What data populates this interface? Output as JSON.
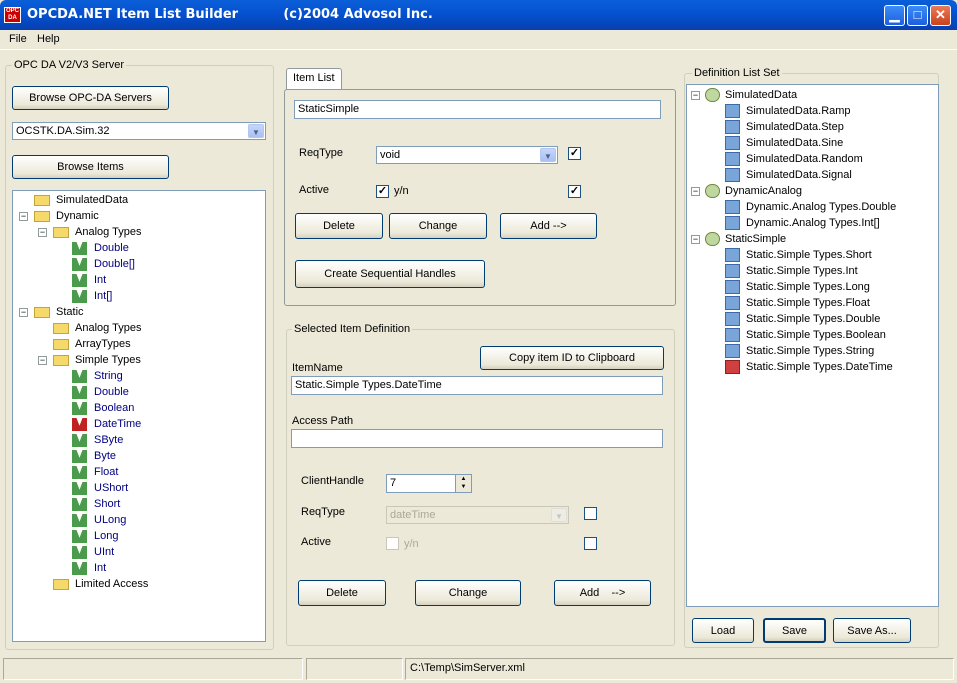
{
  "window": {
    "title": "OPCDA.NET Item List Builder          (c)2004 Advosol Inc.",
    "app_icon_text": "OPC\nDA",
    "minimize_glyph": "▁",
    "maximize_glyph": "□",
    "close_glyph": "✕"
  },
  "menu": {
    "file": "File",
    "help": "Help"
  },
  "server_group": {
    "label": "OPC DA V2/V3 Server",
    "browse_servers_label": "Browse OPC-DA Servers",
    "server_value": "OCSTK.DA.Sim.32",
    "browse_items_label": "Browse Items"
  },
  "browse_tree": {
    "items": [
      {
        "label": "SimulatedData",
        "pm": ""
      },
      {
        "label": "Dynamic",
        "pm": "−"
      },
      {
        "label": "Analog Types",
        "pm": "−"
      },
      {
        "label": "Double"
      },
      {
        "label": "Double[]"
      },
      {
        "label": "Int"
      },
      {
        "label": "Int[]"
      },
      {
        "label": "Static",
        "pm": "−"
      },
      {
        "label": "Analog Types",
        "pm": ""
      },
      {
        "label": "ArrayTypes",
        "pm": ""
      },
      {
        "label": "Simple Types",
        "pm": "−"
      },
      {
        "label": "String"
      },
      {
        "label": "Double"
      },
      {
        "label": "Boolean"
      },
      {
        "label": "DateTime"
      },
      {
        "label": "SByte"
      },
      {
        "label": "Byte"
      },
      {
        "label": "Float"
      },
      {
        "label": "UShort"
      },
      {
        "label": "Short"
      },
      {
        "label": "ULong"
      },
      {
        "label": "Long"
      },
      {
        "label": "UInt"
      },
      {
        "label": "Int"
      },
      {
        "label": "Limited Access",
        "pm": ""
      }
    ]
  },
  "item_list": {
    "tab_label": "Item  List",
    "name_value": "StaticSimple",
    "reqtype_label": "ReqType",
    "reqtype_value": "void",
    "reqtype_checked": "✓",
    "active_label": "Active",
    "active_checked": "✓",
    "yn_label": "y/n",
    "active_right_checked": "✓",
    "delete_label": "Delete",
    "change_label": "Change",
    "add_label": "Add    -->",
    "sequential_label": "Create Sequential Handles"
  },
  "selected_item": {
    "label": "Selected Item Definition",
    "copy_label": "Copy item ID to Clipboard",
    "itemname_label": "ItemName",
    "itemname_value": "Static.Simple Types.DateTime",
    "accesspath_label": "Access Path",
    "accesspath_value": "",
    "clienthandle_label": "ClientHandle",
    "clienthandle_value": "7",
    "spin_up": "▲",
    "spin_down": "▼",
    "reqtype_label": "ReqType",
    "reqtype_value": "dateTime",
    "active_label": "Active",
    "yn_label": "y/n",
    "delete_label": "Delete",
    "change_label": "Change",
    "add_label": "Add    -->"
  },
  "definition": {
    "label": "Definition List Set",
    "items": [
      {
        "label": "SimulatedData",
        "pm": "−"
      },
      {
        "label": "SimulatedData.Ramp"
      },
      {
        "label": "SimulatedData.Step"
      },
      {
        "label": "SimulatedData.Sine"
      },
      {
        "label": "SimulatedData.Random"
      },
      {
        "label": "SimulatedData.Signal"
      },
      {
        "label": "DynamicAnalog",
        "pm": "−"
      },
      {
        "label": "Dynamic.Analog Types.Double"
      },
      {
        "label": "Dynamic.Analog Types.Int[]"
      },
      {
        "label": "StaticSimple",
        "pm": "−"
      },
      {
        "label": "Static.Simple Types.Short"
      },
      {
        "label": "Static.Simple Types.Int"
      },
      {
        "label": "Static.Simple Types.Long"
      },
      {
        "label": "Static.Simple Types.Float"
      },
      {
        "label": "Static.Simple Types.Double"
      },
      {
        "label": "Static.Simple Types.Boolean"
      },
      {
        "label": "Static.Simple Types.String"
      },
      {
        "label": "Static.Simple Types.DateTime"
      }
    ],
    "load_label": "Load",
    "save_label": "Save",
    "saveas_label": "Save As..."
  },
  "status": {
    "panel1": "",
    "panel2": "",
    "panel3": "C:\\Temp\\SimServer.xml"
  }
}
